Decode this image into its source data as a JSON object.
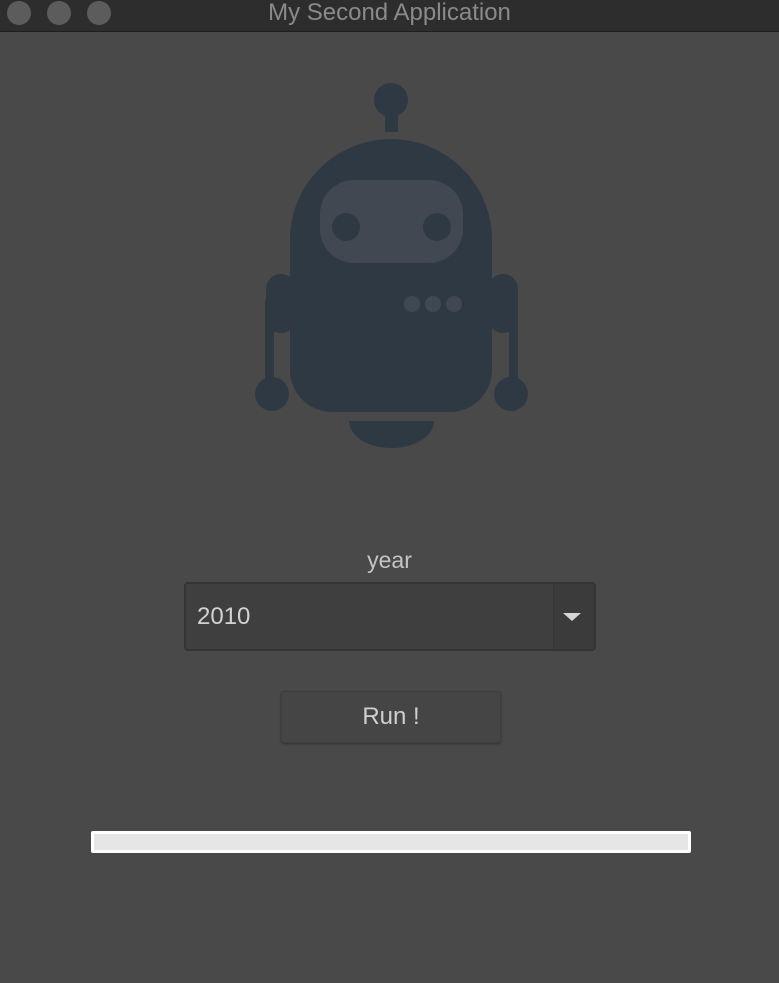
{
  "window": {
    "title": "My Second Application"
  },
  "form": {
    "year_label": "year",
    "year_value": "2010",
    "run_label": "Run !"
  },
  "progress": {
    "value": 0
  },
  "icons": {
    "logo": "robot-icon",
    "dropdown": "chevron-down-icon"
  },
  "colors": {
    "background": "#494949",
    "robot": "#2f3944"
  }
}
